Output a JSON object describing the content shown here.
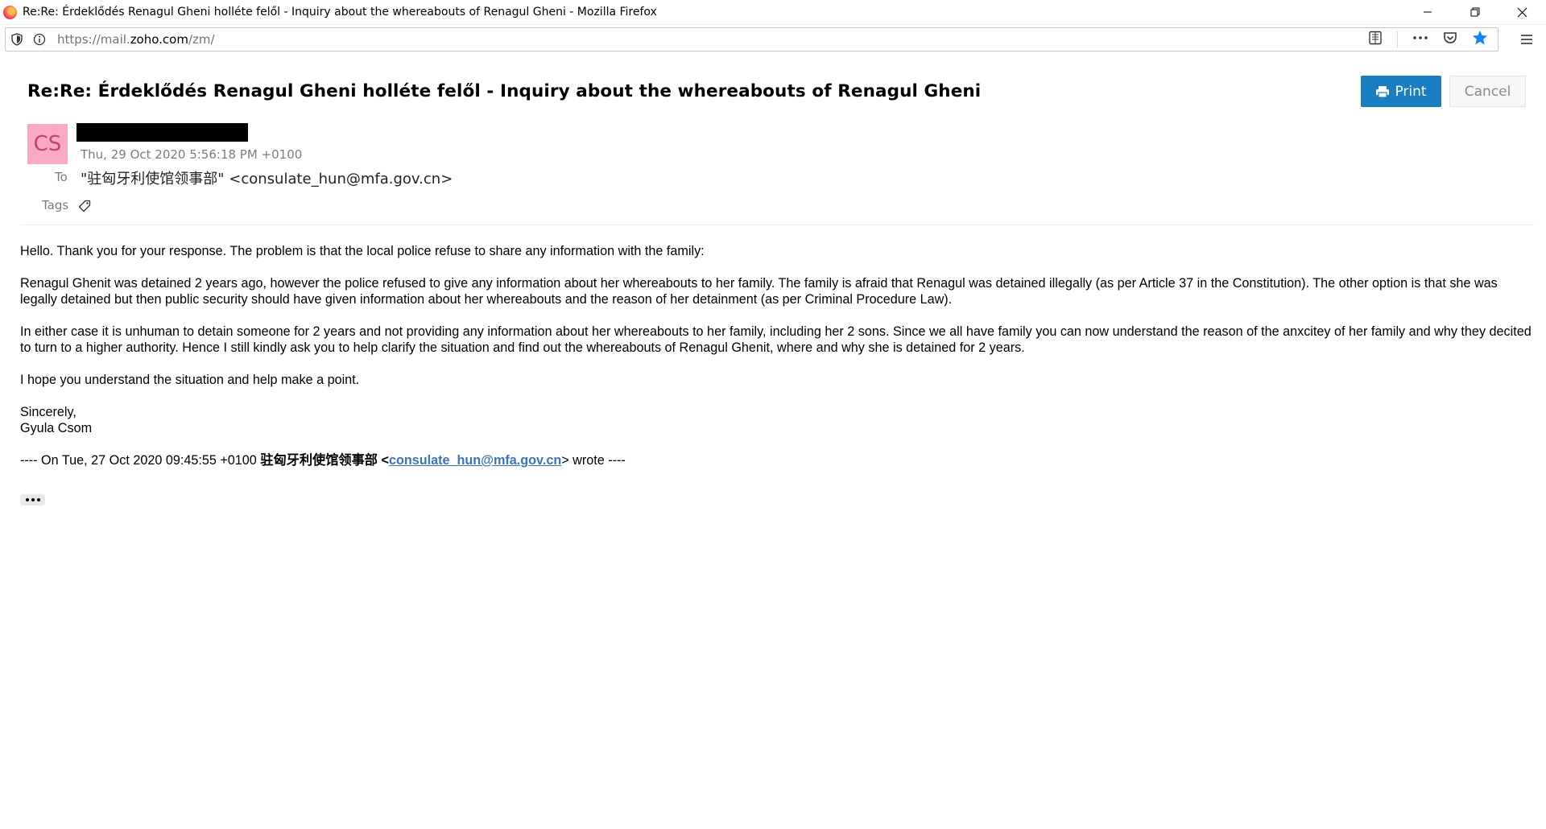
{
  "window": {
    "title": "Re:Re: Érdeklődés Renagul Gheni holléte felől - Inquiry about the whereabouts of Renagul Gheni - Mozilla Firefox"
  },
  "browser": {
    "url_prefix": "https://mail.",
    "url_domain": "zoho.com",
    "url_suffix": "/zm/",
    "bookmark_color": "#0a84ff"
  },
  "email": {
    "subject": "Re:Re: Érdeklődés Renagul Gheni holléte felől - Inquiry about the whereabouts of Renagul Gheni",
    "print_label": "Print",
    "cancel_label": "Cancel",
    "avatar_initials": "CS",
    "date": "Thu, 29 Oct 2020 5:56:18 PM +0100",
    "to_label": "To",
    "to_value": "\"驻匈牙利使馆领事部\" <consulate_hun@mfa.gov.cn>",
    "tags_label": "Tags",
    "body": {
      "p1": "Hello. Thank you for your response. The problem is that the local police refuse to share any information with the family:",
      "p2": "Renagul Ghenit was detained 2 years ago, however the police refused to give any information about her whereabouts to her family. The family is afraid that Renagul was detained illegally (as per Article 37 in the Constitution). The other option is that she was legally detained but then public security should have given information about her whereabouts and the reason of her detainment (as per Criminal Procedure Law).",
      "p3": "In either case it is unhuman to detain someone for 2 years and not providing any information about her whereabouts to her family, including her 2 sons. Since we all have family you can now understand the reason of the anxcitey of her family and why they decited to turn to a higher authority. Hence I still kindly ask you to help clarify the situation and find out the whereabouts of Renagul Ghenit, where and why she is detained for 2 years.",
      "p4": "I hope you understand the situation and help make a point.",
      "sign_off": "Sincerely,",
      "signature": "Gyula Csom",
      "quote_prefix": "---- On Tue, 27 Oct 2020 09:45:55 +0100 ",
      "quote_sender": "驻匈牙利使馆领事部",
      "quote_lt": " <",
      "quote_email": "consulate_hun@mfa.gov.cn",
      "quote_suffix": "> wrote ----"
    },
    "colors": {
      "print_button": "#1a7ec3",
      "avatar_bg": "#f9a9c2",
      "link": "#3b73c4"
    }
  }
}
